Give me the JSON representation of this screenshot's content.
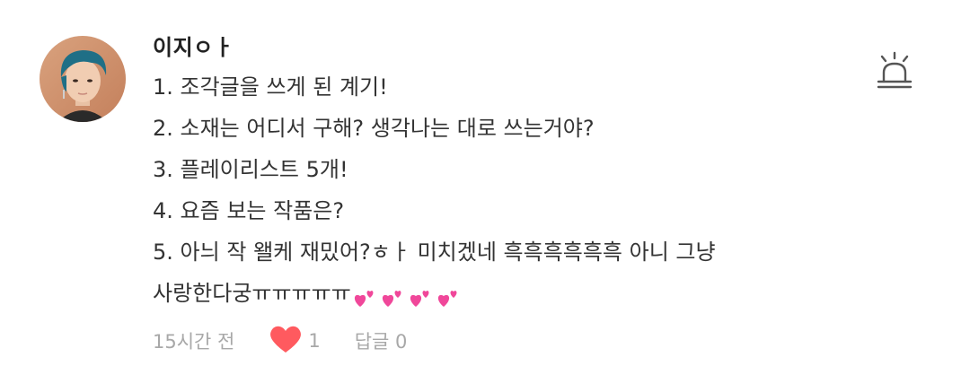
{
  "comment": {
    "username": "이지ㅇㅏ",
    "lines": [
      "1. 조각글을 쓰게 된 계기!",
      "2. 소재는 어디서 구해? 생각나는 대로 쓰는거야?",
      "3. 플레이리스트 5개!",
      "4. 요즘 보는 작품은?",
      "5.  아늬 작 왤케 재밌어?ㅎㅏ  미치겠네 흑흑흑흑흑흑 아니 그냥",
      "사랑한다궁ㅠㅠㅠㅠㅠ"
    ],
    "emoji": "two-hearts-icon x4",
    "time": "15시간 전",
    "like_count": "1",
    "reply_label": "답글 0"
  },
  "colors": {
    "like_heart": "#ff5a5f",
    "hearts_emoji": "#f0479a",
    "meta_text": "#a8a8a8",
    "body_text": "#333333"
  }
}
